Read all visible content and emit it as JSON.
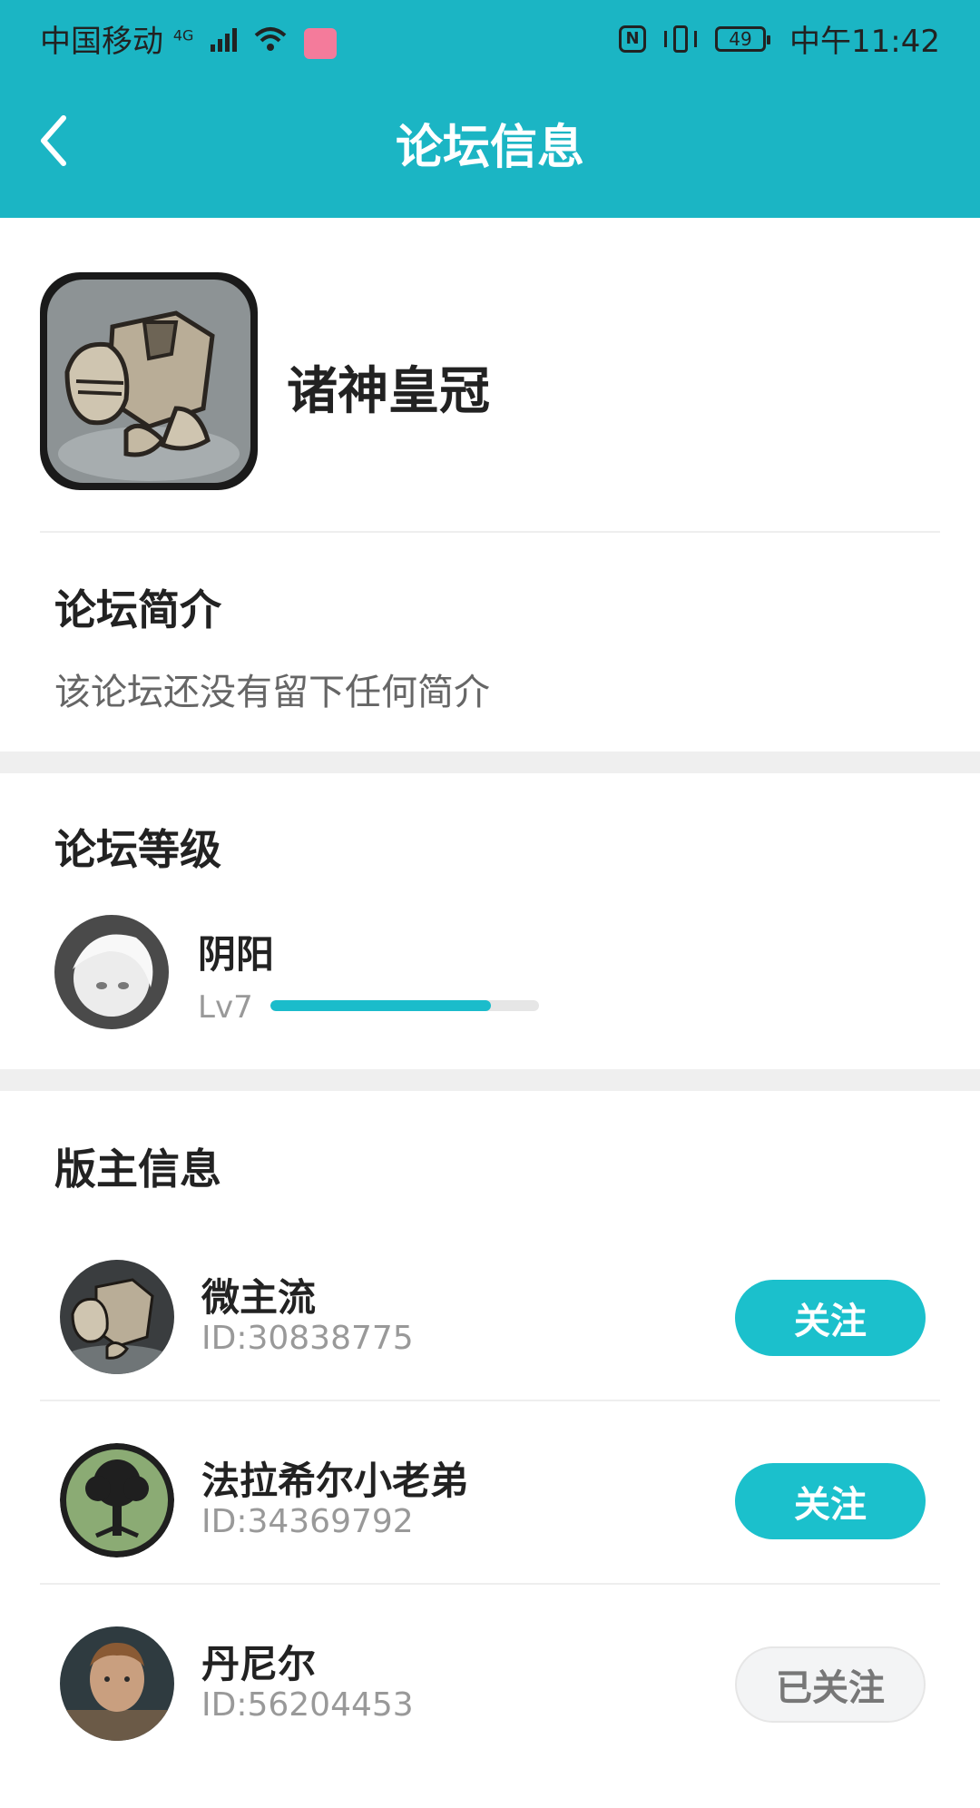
{
  "status_bar": {
    "carrier": "中国移动",
    "network": "4G",
    "battery": "49",
    "time": "中午11:42",
    "nfc": "N"
  },
  "header": {
    "title": "论坛信息",
    "color": "#1bb5c4"
  },
  "forum": {
    "name": "诸神皇冠",
    "icon": "armor-icon"
  },
  "intro": {
    "title": "论坛简介",
    "text": "该论坛还没有留下任何简介"
  },
  "level": {
    "title": "论坛等级",
    "name": "阴阳",
    "level_label": "Lv7",
    "progress": 0.82
  },
  "moderators": {
    "title": "版主信息",
    "items": [
      {
        "name": "微主流",
        "id": "ID:30838775",
        "button": "关注",
        "followed": false
      },
      {
        "name": "法拉希尔小老弟",
        "id": "ID:34369792",
        "button": "关注",
        "followed": false
      },
      {
        "name": "丹尼尔",
        "id": "ID:56204453",
        "button": "已关注",
        "followed": true
      }
    ]
  }
}
